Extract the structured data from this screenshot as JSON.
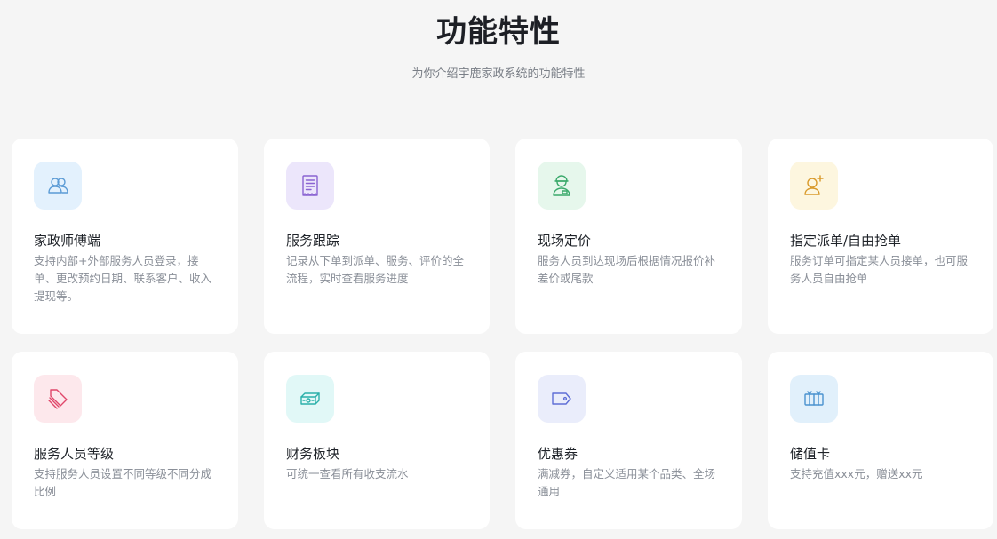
{
  "header": {
    "title": "功能特性",
    "subtitle": "为你介绍宇鹿家政系统的功能特性"
  },
  "features": [
    {
      "title": "家政师傅端",
      "desc": "支持内部+外部服务人员登录，接单、更改预约日期、联系客户、收入提现等。",
      "icon": "users-icon",
      "icon_bg": "#e3f1fd",
      "icon_color": "#5b9bd5"
    },
    {
      "title": "服务跟踪",
      "desc": "记录从下单到派单、服务、评价的全流程，实时查看服务进度",
      "icon": "document-icon",
      "icon_bg": "#ece6fb",
      "icon_color": "#8a63d2"
    },
    {
      "title": "现场定价",
      "desc": "服务人员到达现场后根据情况报价补差价或尾款",
      "icon": "worker-icon",
      "icon_bg": "#e6f7ec",
      "icon_color": "#3aa96b"
    },
    {
      "title": "指定派单/自由抢单",
      "desc": "服务订单可指定某人员接单，也可服务人员自由抢单",
      "icon": "add-user-icon",
      "icon_bg": "#fdf6df",
      "icon_color": "#d99a2b"
    },
    {
      "title": "服务人员等级",
      "desc": "支持服务人员设置不同等级不同分成比例",
      "icon": "tag-stack-icon",
      "icon_bg": "#fde8ec",
      "icon_color": "#e0476a"
    },
    {
      "title": "财务板块",
      "desc": "可统一查看所有收支流水",
      "icon": "money-icon",
      "icon_bg": "#e1f8f7",
      "icon_color": "#2bb0aa"
    },
    {
      "title": "优惠券",
      "desc": "满减券，自定义适用某个品类、全场通用",
      "icon": "coupon-icon",
      "icon_bg": "#eaedfb",
      "icon_color": "#5f6fd6"
    },
    {
      "title": "储值卡",
      "desc": "支持充值xxx元，赠送xx元",
      "icon": "gift-card-icon",
      "icon_bg": "#e1f0fb",
      "icon_color": "#4a92cf"
    }
  ]
}
